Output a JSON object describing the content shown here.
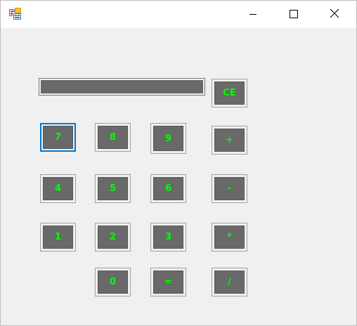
{
  "window": {
    "title": "",
    "controls": {
      "minimize_icon": "minimize-icon",
      "maximize_icon": "maximize-icon",
      "close_icon": "close-icon"
    }
  },
  "display": {
    "value": ""
  },
  "keys": {
    "ce": "CE",
    "seven": "7",
    "eight": "8",
    "nine": "9",
    "plus": "+",
    "four": "4",
    "five": "5",
    "six": "6",
    "minus": "-",
    "one": "1",
    "two": "2",
    "three": "3",
    "multiply": "*",
    "zero": "0",
    "equals": "=",
    "divide": "/"
  },
  "colors": {
    "key_face": "#696969",
    "key_text": "#00ff00",
    "focus_border": "#0078d7",
    "window_bg": "#f0f0f0"
  }
}
